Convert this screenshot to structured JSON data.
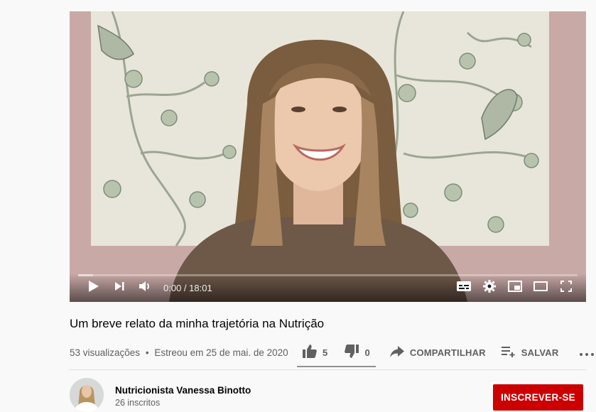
{
  "player": {
    "time_display": "0:00 / 18:01",
    "progress_fraction": 0.0,
    "buffered_fraction": 0.03,
    "icons": [
      "play-icon",
      "next-icon",
      "volume-icon",
      "subtitles-icon",
      "settings-icon",
      "miniplayer-icon",
      "theater-mode-icon",
      "fullscreen-icon"
    ]
  },
  "video": {
    "title": "Um breve relato da minha trajetória na Nutrição",
    "views": "53 visualizações",
    "separator": "•",
    "premiered": "Estreou em 25 de mai. de 2020"
  },
  "actions": {
    "likes": "5",
    "dislikes": "0",
    "share_label": "COMPARTILHAR",
    "save_label": "SALVAR",
    "like_ratio": 1.0
  },
  "channel": {
    "name": "Nutricionista Vanessa Binotto",
    "subscribers": "26 inscritos",
    "subscribe_label": "INSCREVER-SE"
  },
  "colors": {
    "subscribe_bg": "#cc0000",
    "meta_text": "#606060",
    "page_bg": "#f9f9f9"
  }
}
